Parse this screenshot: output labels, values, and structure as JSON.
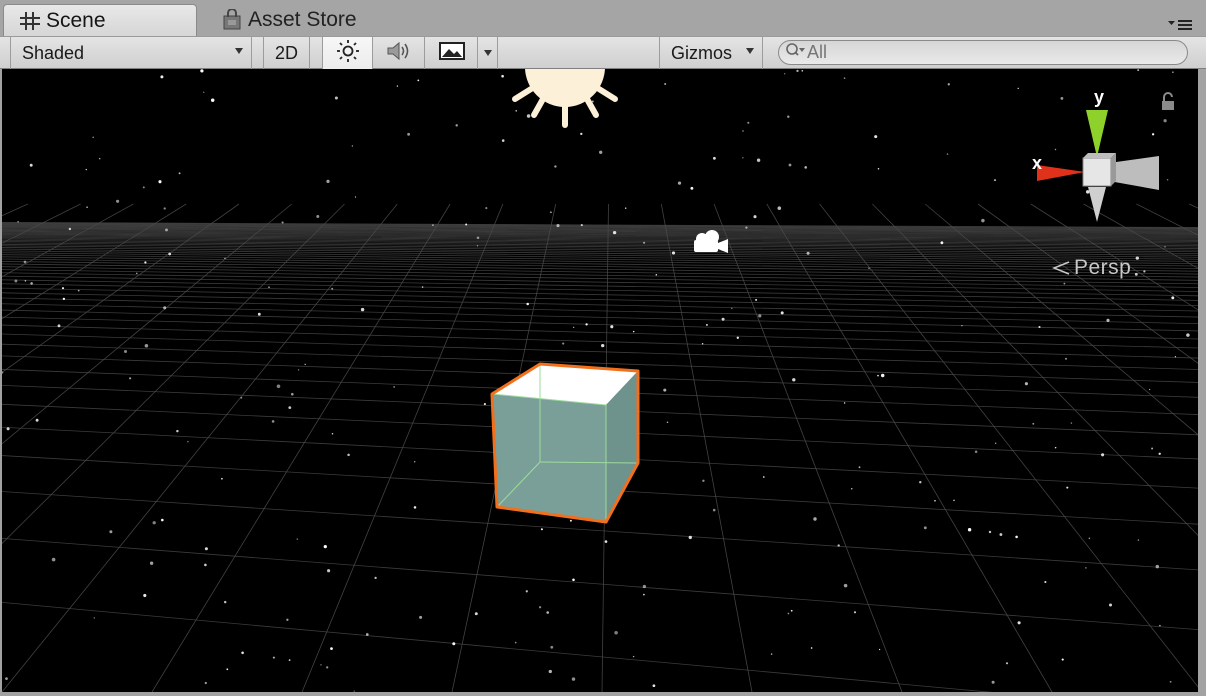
{
  "tabs": [
    {
      "label": "Scene",
      "icon": "scene-grid-icon",
      "active": true
    },
    {
      "label": "Asset Store",
      "icon": "shopping-bag-icon",
      "active": false
    }
  ],
  "toolbar": {
    "draw_mode": "Shaded",
    "mode_2d_label": "2D",
    "lighting_icon": "sun-icon",
    "audio_icon": "speaker-icon",
    "effects_icon": "image-icon",
    "gizmos_label": "Gizmos",
    "search_placeholder": "All"
  },
  "viewport": {
    "projection_label": "Persp",
    "axis_x_label": "x",
    "axis_y_label": "y",
    "background_color": "#000000",
    "selection_outline_color": "#f26f1c",
    "cube_face_color": "#7a9f98",
    "cube_top_color": "#ffffff"
  }
}
